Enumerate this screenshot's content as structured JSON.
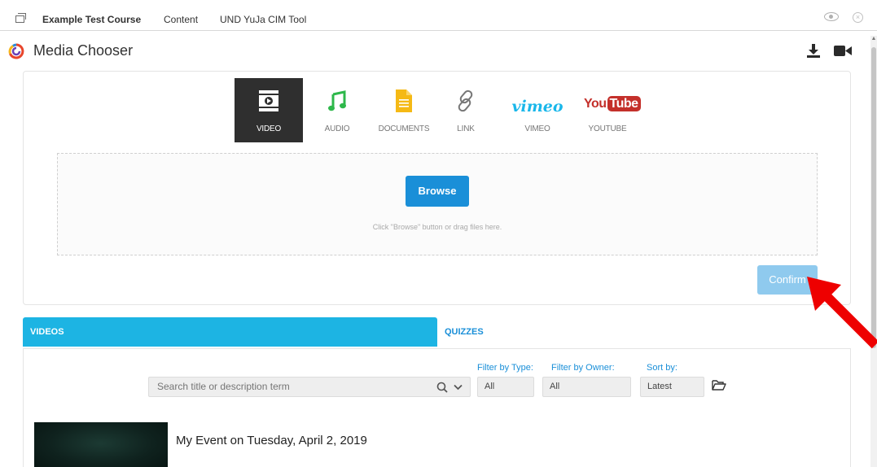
{
  "topbar": {
    "breadcrumbs": [
      "Example Test Course",
      "Content",
      "UND YuJa CIM Tool"
    ]
  },
  "header": {
    "title": "Media Chooser",
    "icons": [
      "download-icon",
      "camera-icon"
    ]
  },
  "media_types": [
    {
      "label": "VIDEO",
      "icon": "video-icon",
      "active": true
    },
    {
      "label": "AUDIO",
      "icon": "music-note-icon",
      "active": false
    },
    {
      "label": "DOCUMENTS",
      "icon": "document-icon",
      "active": false
    },
    {
      "label": "LINK",
      "icon": "link-icon",
      "active": false
    },
    {
      "label": "VIMEO",
      "icon": "vimeo-logo",
      "logo_text": "vimeo",
      "active": false
    },
    {
      "label": "YOUTUBE",
      "icon": "youtube-logo",
      "logo_text_a": "You",
      "logo_text_b": "Tube",
      "active": false
    }
  ],
  "upload": {
    "browse_label": "Browse",
    "hint": "Click \"Browse\" button or drag files here.",
    "confirm_label": "Confirm"
  },
  "tabs": [
    {
      "label": "VIDEOS",
      "active": true
    },
    {
      "label": "QUIZZES",
      "active": false
    }
  ],
  "filters": {
    "search_placeholder": "Search title or description term",
    "type_label": "Filter by Type:",
    "type_value": "All",
    "owner_label": "Filter by Owner:",
    "owner_value": "All",
    "sort_label": "Sort by:",
    "sort_value": "Latest"
  },
  "media_list": [
    {
      "title": "My Event on Tuesday, April 2, 2019"
    }
  ],
  "colors": {
    "accent_blue": "#1a8fd8",
    "tab_blue": "#1db4e3",
    "confirm_blue": "#8fcaee",
    "active_tab_bg": "#2f2f2f",
    "arrow_red": "#ee0000"
  }
}
